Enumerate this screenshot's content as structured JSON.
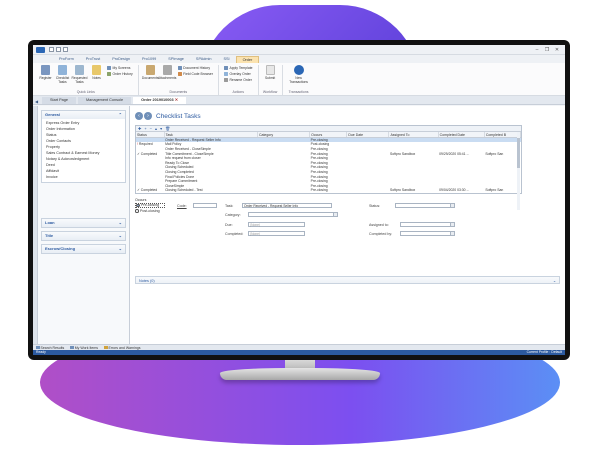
{
  "ribbon_tabs": [
    "ProForm",
    "ProTrust",
    "ProDesign",
    "Pro1099",
    "SPImage",
    "SPAdmin",
    "SSI",
    "Order"
  ],
  "ribbon_active_tab": "Order",
  "ribbon": {
    "quick_links": {
      "label": "Quick Links",
      "buttons": [
        "Register",
        "Checklist Tasks",
        "Requested Tasks",
        "Notes"
      ],
      "side_items": [
        "My Screens",
        "Order History"
      ]
    },
    "documents": {
      "label": "Documents",
      "buttons": [
        "Documents",
        "Attachments"
      ],
      "side_items": [
        "Document History",
        "Field Code Browser"
      ]
    },
    "actions": {
      "label": "Actions",
      "side_items": [
        "Apply Template",
        "Overlay Order",
        "Rename Order"
      ]
    },
    "workflow": {
      "label": "Workflow",
      "buttons": [
        "Submit"
      ]
    },
    "transactions": {
      "label": "Transactions",
      "buttons": [
        "New Transactions"
      ]
    }
  },
  "doc_tabs": [
    "Start Page",
    "Management Console",
    "Order 2019010003"
  ],
  "sidebar": {
    "general": {
      "title": "General",
      "items": [
        "Express Order Entry",
        "Order Information",
        "Status",
        "Order Contacts",
        "Property",
        "Sales Contract & Earnest Money",
        "Notary & Acknowledgment",
        "Deed",
        "Affidavit",
        "Invoice"
      ]
    },
    "sections": [
      "Loan",
      "Title",
      "Escrow/Closing"
    ]
  },
  "content_title": "Checklist Tasks",
  "grid": {
    "columns": [
      "Status",
      "Task",
      "Category",
      "Occurs",
      "Due Date",
      "Assigned To",
      "Completed Date",
      "Completed B"
    ],
    "rows": [
      [
        "",
        "Order Received - Request Seller Info",
        "",
        "Pre-closing",
        "",
        "",
        "",
        ""
      ],
      [
        "Required",
        "Mail Policy",
        "",
        "Post-closing",
        "",
        "",
        "",
        ""
      ],
      [
        "",
        "Order Received - CloseSimple",
        "",
        "Pre-closing",
        "",
        "",
        "",
        ""
      ],
      [
        "Completed",
        "Title Commitment - CloseSimple",
        "",
        "Pre-closing",
        "",
        "Softpro Sandbox",
        "09/29/2020 05:41 ...",
        "Softpro San"
      ],
      [
        "",
        "Info request from closer",
        "",
        "Pre-closing",
        "",
        "",
        "",
        ""
      ],
      [
        "",
        "Ready To Close",
        "",
        "Pre-closing",
        "",
        "",
        "",
        ""
      ],
      [
        "",
        "Closing Scheduled",
        "",
        "Pre-closing",
        "",
        "",
        "",
        ""
      ],
      [
        "",
        "Closing Completed",
        "",
        "Pre-closing",
        "",
        "",
        "",
        ""
      ],
      [
        "",
        "Final Policies Done",
        "",
        "Pre-closing",
        "",
        "",
        "",
        ""
      ],
      [
        "",
        "Prepare Commitment",
        "",
        "Pre-closing",
        "",
        "",
        "",
        ""
      ],
      [
        "",
        "CloseSimple",
        "",
        "Pre-closing",
        "",
        "",
        "",
        ""
      ],
      [
        "Completed",
        "Closing Scheduled - Test",
        "",
        "Pre-closing",
        "",
        "Softpro Sandbox",
        "09/04/2020 03:30 ...",
        "Softpro San"
      ]
    ]
  },
  "form": {
    "occurs_label": "Occurs",
    "occurs_options": [
      "Pre-closing",
      "Post-closing"
    ],
    "code_label": "Code:",
    "task_label": "Task:",
    "task_value": "Order Received - Request Seller Info",
    "status_label": "Status:",
    "category_label": "Category:",
    "due_label": "Due:",
    "due_value": "(None)",
    "completed_label": "Completed:",
    "completed_value": "(None)",
    "assigned_label": "Assigned to:",
    "completed_by_label": "Completed by:"
  },
  "notes_label": "Notes (0)",
  "bottom_tabs": [
    "Search Results",
    "My Work Items",
    "Errors and Warnings"
  ],
  "status_left": "Ready",
  "status_right": "Current Profile : Default"
}
